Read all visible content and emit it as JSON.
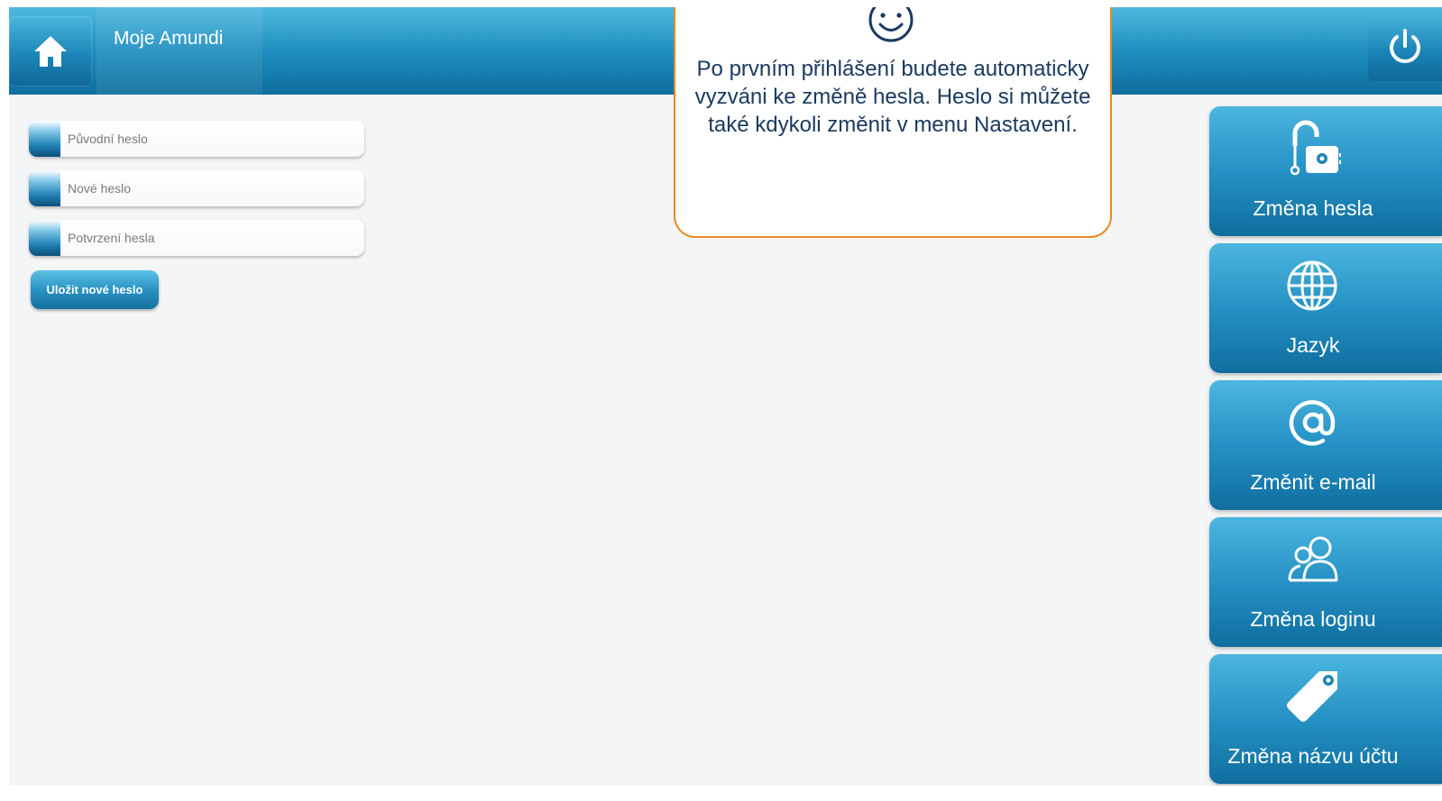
{
  "header": {
    "title": "Moje Amundi",
    "home_icon": "home-icon",
    "power_icon": "power-icon"
  },
  "form": {
    "fields": [
      {
        "placeholder": "Původní heslo"
      },
      {
        "placeholder": "Nové heslo"
      },
      {
        "placeholder": "Potvrzení hesla"
      }
    ],
    "save_label": "Uložit nové heslo"
  },
  "tooltip": {
    "icon": "smiley-icon",
    "message": "Po prvním přihlášení budete automaticky vyzváni ke změně hesla. Heslo si můžete také kdykoli změnit v menu Nastavení."
  },
  "sidebar": {
    "items": [
      {
        "label": "Změna hesla",
        "icon": "lock-icon"
      },
      {
        "label": "Jazyk",
        "icon": "globe-icon"
      },
      {
        "label": "Změnit e-mail",
        "icon": "at-icon"
      },
      {
        "label": "Změna loginu",
        "icon": "users-icon"
      },
      {
        "label": "Změna názvu účtu",
        "icon": "tag-icon"
      }
    ]
  },
  "colors": {
    "header_blue": "#1f8fbf",
    "tooltip_border": "#e98a1f",
    "tooltip_text": "#1a3a60"
  }
}
